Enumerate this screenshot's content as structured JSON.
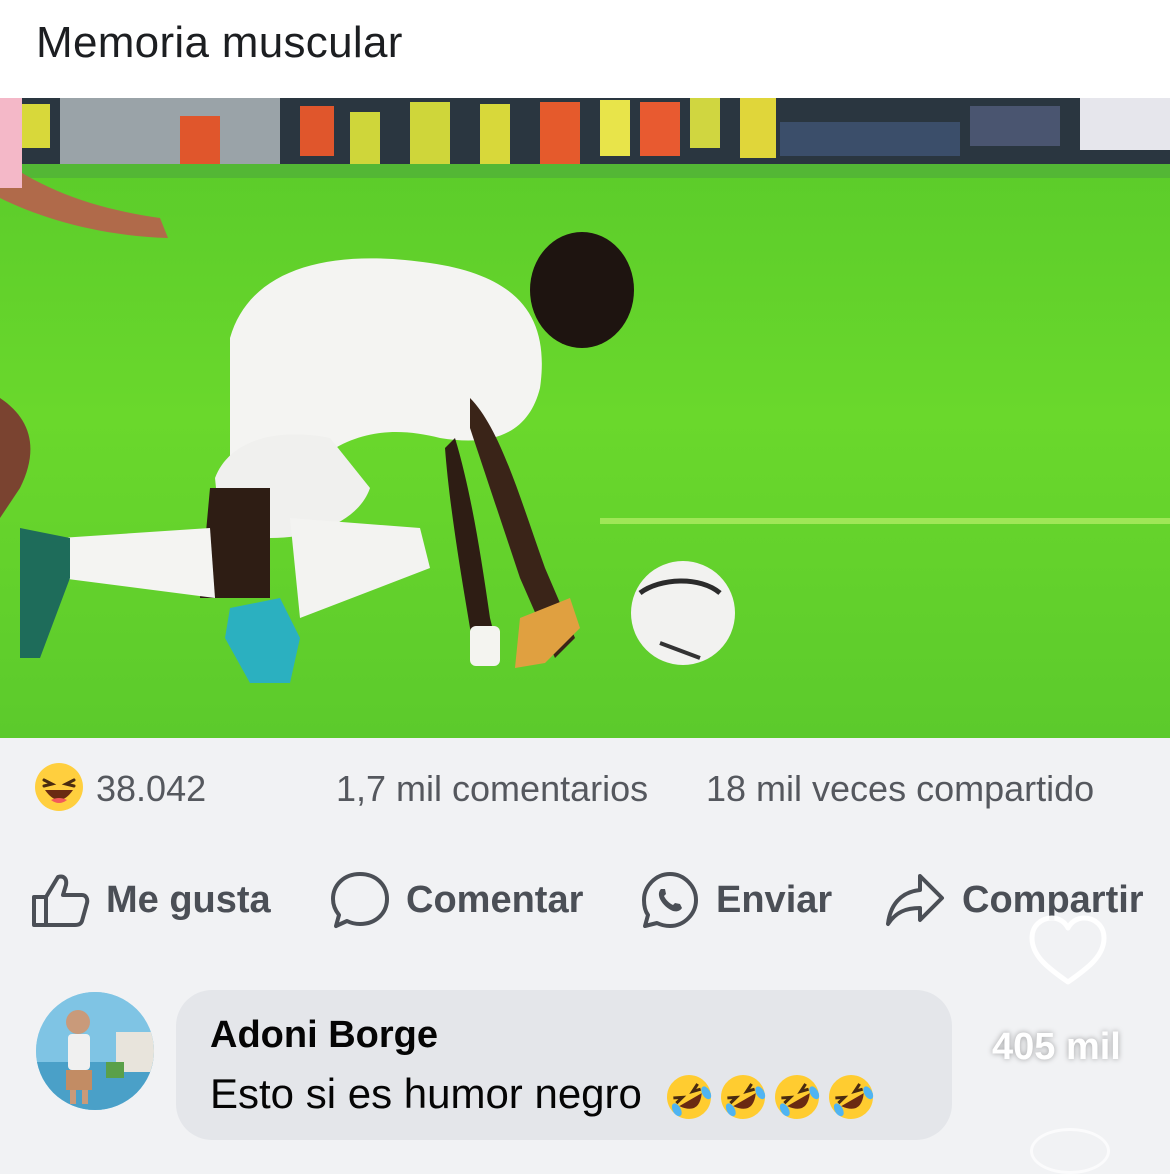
{
  "post": {
    "caption": "Memoria muscular"
  },
  "stats": {
    "reaction_icon": "laughing-face-icon",
    "reaction_count": "38.042",
    "comments": "1,7 mil comentarios",
    "shares": "18 mil veces compartido"
  },
  "actions": {
    "like_label": "Me gusta",
    "comment_label": "Comentar",
    "send_label": "Enviar",
    "share_label": "Compartir"
  },
  "comment": {
    "author": "Adoni Borge",
    "text": "Esto si es humor negro",
    "emoji": [
      "rolling-on-floor-laughing-icon",
      "rolling-on-floor-laughing-icon",
      "rolling-on-floor-laughing-icon",
      "rolling-on-floor-laughing-icon"
    ]
  },
  "overlay": {
    "heart_icon": "heart-outline-icon",
    "like_count": "405 mil"
  },
  "colors": {
    "pitch_green": "#63d62a",
    "accent_text": "#4b4f56",
    "bubble_bg": "#e4e6ea"
  }
}
